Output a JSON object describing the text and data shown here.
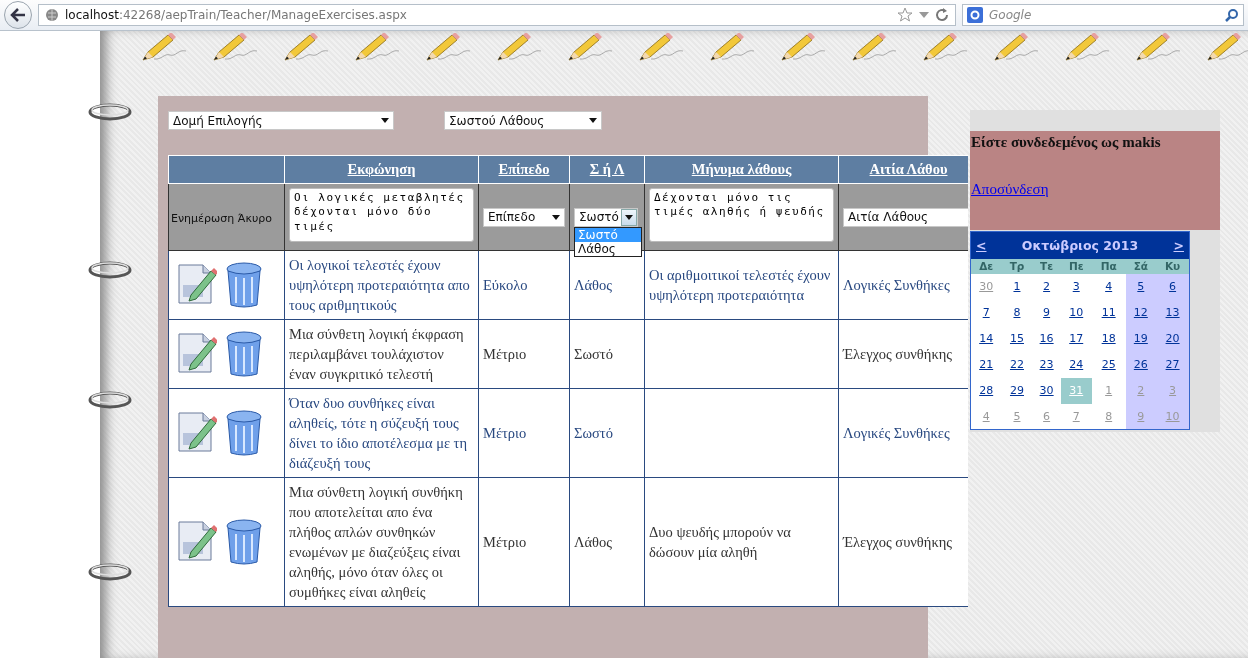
{
  "browser": {
    "url": "**localhost**:42268/aepTrain/Teacher/ManageExercises.aspx",
    "search_placeholder": "Google"
  },
  "filters": [
    {
      "value": "Δομή Επιλογής"
    },
    {
      "value": "Σωστού Λάθους"
    }
  ],
  "table": {
    "columns": [
      "Εκφώνηση",
      "Επίπεδο",
      "Σ ή Λ",
      "Μήνυμα λάθους",
      "Αιτία Λάθου"
    ],
    "edit_row": {
      "update": "Ενημέρωση",
      "cancel": "Άκυρο",
      "statement": "Οι λογικές μεταβλητές δέχονται μόνο δύο τιμές",
      "level": "Επίπεδο",
      "answer": "Σωστό",
      "answer_options": [
        {
          "label": "Σωστό",
          "selected": true
        },
        {
          "label": "Λάθος",
          "selected": false
        }
      ],
      "error_message": "Δέχονται μόνο τις τιμές αληθής ή ψευδής",
      "error_cause": "Αιτία Λάθους"
    },
    "rows": [
      {
        "alternate": true,
        "statement": "Οι λογικοί τελεστές έχουν υψηλότερη προτεραιότητα απο τους αριθμητικούς",
        "level": "Εύκολο",
        "answer": "Λάθος",
        "error_message": "Οι αριθμοιτικοί τελεστές έχουν υψηλότερη προτεραιότητα",
        "error_cause": "Λογικές Συνθήκες"
      },
      {
        "alternate": false,
        "statement": "Μια σύνθετη λογική έκφραση περιλαμβάνει τουλάχιστον έναν συγκριτικό τελεστή",
        "level": "Μέτριο",
        "answer": "Σωστό",
        "error_message": "",
        "error_cause": "Έλεγχος συνθήκης"
      },
      {
        "alternate": true,
        "statement": "Όταν δυο συνθήκες είναι αληθείς, τότε η σύζευξή τους δίνει το ίδιο αποτέλεσμα με τη διάζευξή τους",
        "level": "Μέτριο",
        "answer": "Σωστό",
        "error_message": "",
        "error_cause": "Λογικές Συνθήκες"
      },
      {
        "alternate": false,
        "statement": "Μια σύνθετη λογική συνθήκη που αποτελείται απο ένα πλήθος απλών συνθηκών ενωμένων με διαζεύξεις είναι αληθής, μόνο όταν όλες οι συμθήκες είναι αληθείς",
        "level": "Μέτριο",
        "answer": "Λάθος",
        "error_message": "Δυο ψευδής μπορούν να δώσουν μία αληθή",
        "error_cause": "Έλεγχος συνθήκης"
      }
    ]
  },
  "login": {
    "message": "Είστε συνδεδεμένος ως makis",
    "logout": "Αποσύνδεση"
  },
  "calendar": {
    "prev": "<",
    "next": ">",
    "title": "Οκτώβριος 2013",
    "weekdays": [
      "Δε",
      "Τρ",
      "Τε",
      "Πε",
      "Πα",
      "Σά",
      "Κυ"
    ],
    "weeks": [
      [
        {
          "day": "30",
          "other_month": true,
          "selected": false
        },
        {
          "day": "1",
          "other_month": false,
          "selected": false
        },
        {
          "day": "2",
          "other_month": false,
          "selected": false
        },
        {
          "day": "3",
          "other_month": false,
          "selected": false
        },
        {
          "day": "4",
          "other_month": false,
          "selected": false
        },
        {
          "day": "5",
          "other_month": false,
          "selected": false
        },
        {
          "day": "6",
          "other_month": false,
          "selected": false
        }
      ],
      [
        {
          "day": "7",
          "other_month": false,
          "selected": false
        },
        {
          "day": "8",
          "other_month": false,
          "selected": false
        },
        {
          "day": "9",
          "other_month": false,
          "selected": false
        },
        {
          "day": "10",
          "other_month": false,
          "selected": false
        },
        {
          "day": "11",
          "other_month": false,
          "selected": false
        },
        {
          "day": "12",
          "other_month": false,
          "selected": false
        },
        {
          "day": "13",
          "other_month": false,
          "selected": false
        }
      ],
      [
        {
          "day": "14",
          "other_month": false,
          "selected": false
        },
        {
          "day": "15",
          "other_month": false,
          "selected": false
        },
        {
          "day": "16",
          "other_month": false,
          "selected": false
        },
        {
          "day": "17",
          "other_month": false,
          "selected": false
        },
        {
          "day": "18",
          "other_month": false,
          "selected": false
        },
        {
          "day": "19",
          "other_month": false,
          "selected": false
        },
        {
          "day": "20",
          "other_month": false,
          "selected": false
        }
      ],
      [
        {
          "day": "21",
          "other_month": false,
          "selected": false
        },
        {
          "day": "22",
          "other_month": false,
          "selected": false
        },
        {
          "day": "23",
          "other_month": false,
          "selected": false
        },
        {
          "day": "24",
          "other_month": false,
          "selected": false
        },
        {
          "day": "25",
          "other_month": false,
          "selected": false
        },
        {
          "day": "26",
          "other_month": false,
          "selected": false
        },
        {
          "day": "27",
          "other_month": false,
          "selected": false
        }
      ],
      [
        {
          "day": "28",
          "other_month": false,
          "selected": false
        },
        {
          "day": "29",
          "other_month": false,
          "selected": false
        },
        {
          "day": "30",
          "other_month": false,
          "selected": false
        },
        {
          "day": "31",
          "other_month": false,
          "selected": true
        },
        {
          "day": "1",
          "other_month": true,
          "selected": false
        },
        {
          "day": "2",
          "other_month": true,
          "selected": false
        },
        {
          "day": "3",
          "other_month": true,
          "selected": false
        }
      ],
      [
        {
          "day": "4",
          "other_month": true,
          "selected": false
        },
        {
          "day": "5",
          "other_month": true,
          "selected": false
        },
        {
          "day": "6",
          "other_month": true,
          "selected": false
        },
        {
          "day": "7",
          "other_month": true,
          "selected": false
        },
        {
          "day": "8",
          "other_month": true,
          "selected": false
        },
        {
          "day": "9",
          "other_month": true,
          "selected": false
        },
        {
          "day": "10",
          "other_month": true,
          "selected": false
        }
      ]
    ]
  }
}
